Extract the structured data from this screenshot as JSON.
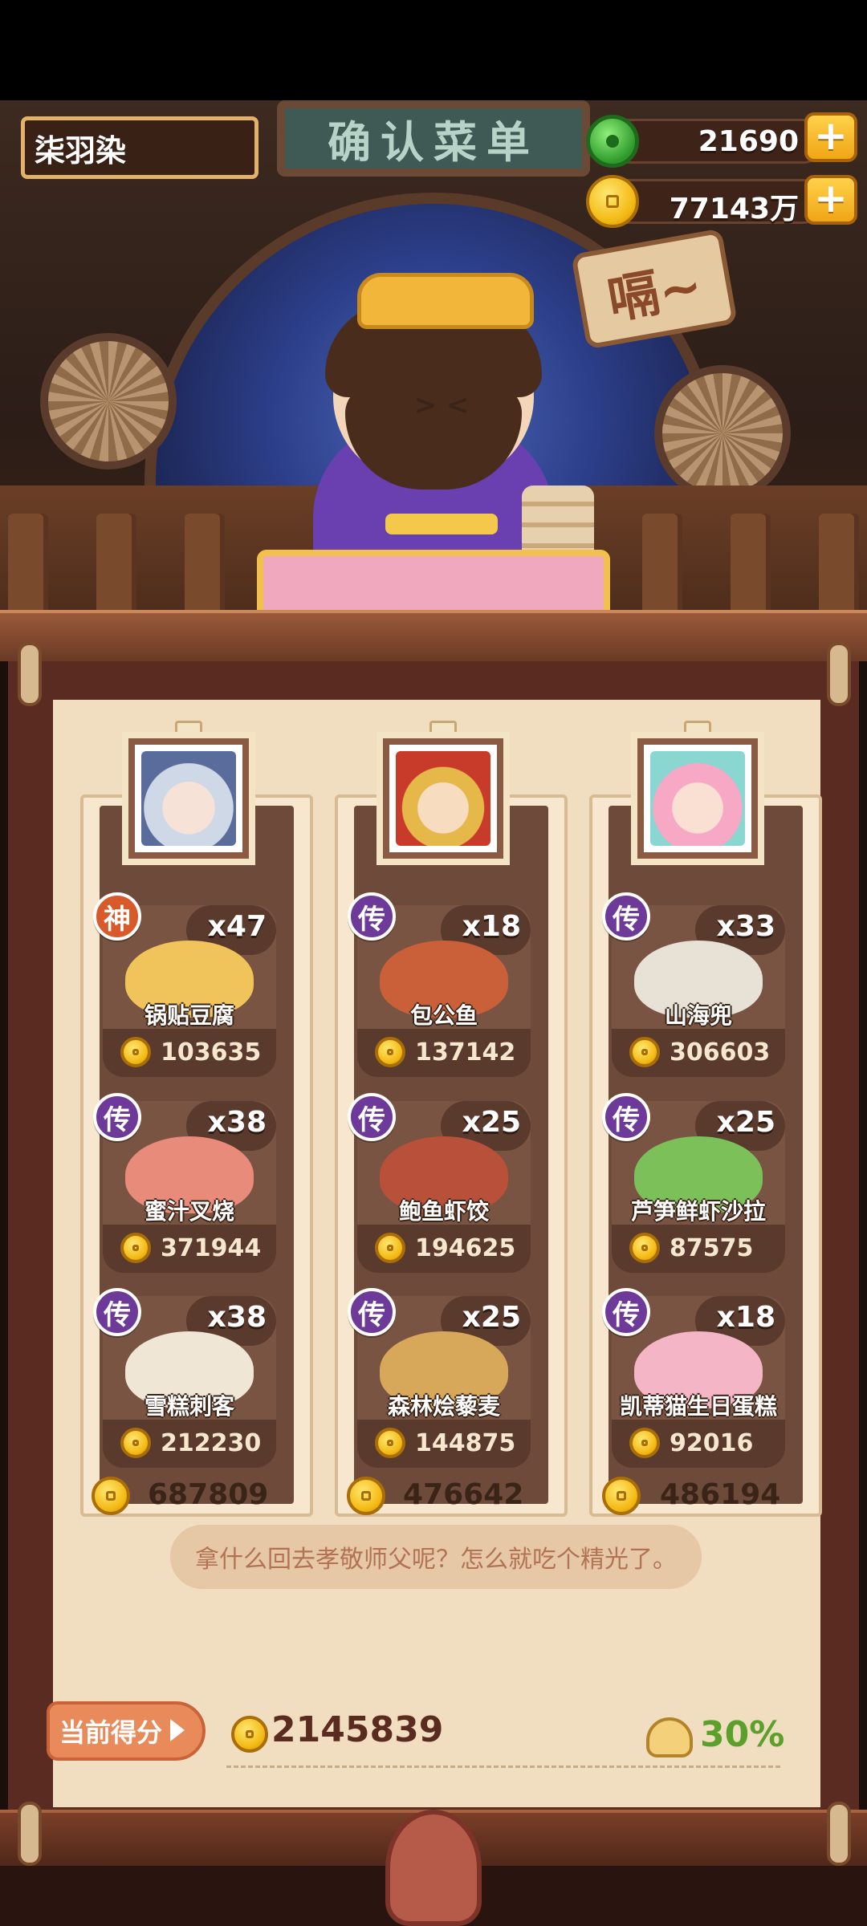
{
  "sign_title": "确认菜单",
  "sound_text": "嗝~",
  "player": {
    "name": "柒羽染"
  },
  "resources": {
    "jade": {
      "value": "21690",
      "icon": "jade-icon",
      "plus": "+"
    },
    "gold": {
      "value": "77143万",
      "icon": "coin-icon",
      "plus": "+"
    }
  },
  "columns": [
    {
      "portrait": "portrait-silver-hair",
      "dishes": [
        {
          "badge": "神",
          "count": "x47",
          "name": "锅贴豆腐",
          "price": "103635",
          "color": "#f0c45a"
        },
        {
          "badge": "传",
          "count": "x38",
          "name": "蜜汁叉烧",
          "price": "371944",
          "color": "#e98b7a"
        },
        {
          "badge": "传",
          "count": "x38",
          "name": "雪糕刺客",
          "price": "212230",
          "color": "#efe6d6"
        }
      ],
      "total": "687809"
    },
    {
      "portrait": "portrait-golden-crown",
      "dishes": [
        {
          "badge": "传",
          "count": "x18",
          "name": "包公鱼",
          "price": "137142",
          "color": "#c9603a"
        },
        {
          "badge": "传",
          "count": "x25",
          "name": "鲍鱼虾饺",
          "price": "194625",
          "color": "#b8503a"
        },
        {
          "badge": "传",
          "count": "x25",
          "name": "森林烩藜麦",
          "price": "144875",
          "color": "#d7a85a"
        }
      ],
      "total": "476642"
    },
    {
      "portrait": "portrait-pink-hair",
      "dishes": [
        {
          "badge": "传",
          "count": "x33",
          "name": "山海兜",
          "price": "306603",
          "color": "#e8e2d6"
        },
        {
          "badge": "传",
          "count": "x25",
          "name": "芦笋鲜虾沙拉",
          "price": "87575",
          "color": "#7cc05a"
        },
        {
          "badge": "传",
          "count": "x18",
          "name": "凯蒂猫生日蛋糕",
          "price": "92016",
          "color": "#f4b6c6"
        }
      ],
      "total": "486194"
    }
  ],
  "quote": "拿什么回去孝敬师父呢？怎么就吃个精光了。",
  "score": {
    "label": "当前得分",
    "value": "2145839",
    "percent": "30%"
  },
  "colors": {
    "paper": "#f1ddbf",
    "card": "#7a5443",
    "accent_orange": "#e88a5a",
    "percent_green": "#5aa02a"
  }
}
